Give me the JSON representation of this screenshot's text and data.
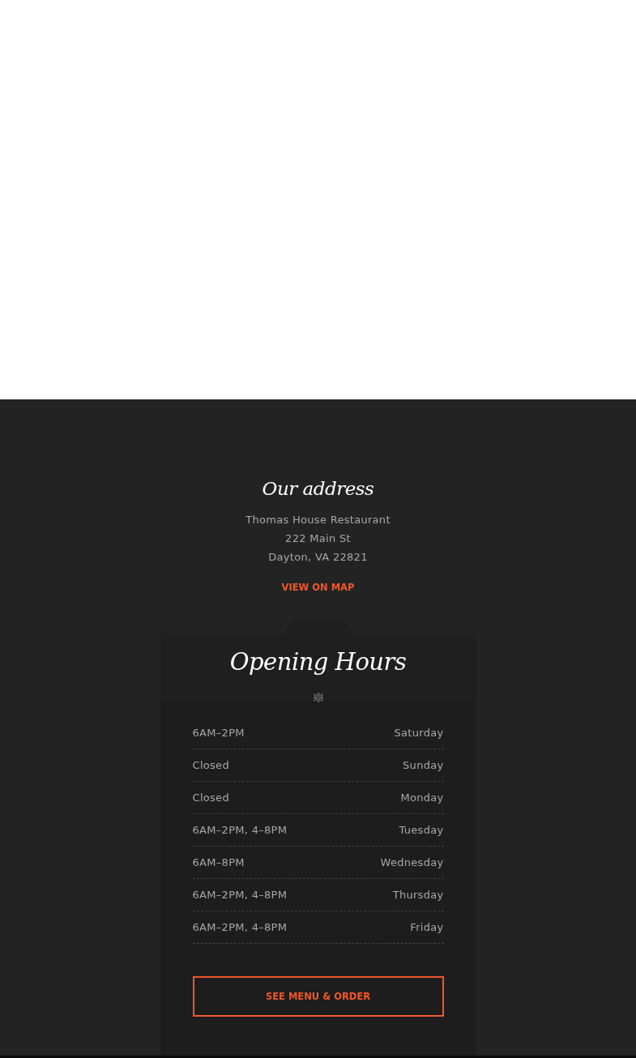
{
  "address": {
    "title": "Our address",
    "lines": [
      "Thomas House Restaurant",
      "222 Main St",
      "Dayton, VA 22821"
    ],
    "link": "VIEW ON MAP"
  },
  "hours": {
    "title": "Opening Hours",
    "rows": [
      {
        "time": "6AM–2PM",
        "day": "Saturday"
      },
      {
        "time": "Closed",
        "day": "Sunday"
      },
      {
        "time": "Closed",
        "day": "Monday"
      },
      {
        "time": "6AM–2PM, 4–8PM",
        "day": "Tuesday"
      },
      {
        "time": "6AM–8PM",
        "day": "Wednesday"
      },
      {
        "time": "6AM–2PM, 4–8PM",
        "day": "Thursday"
      },
      {
        "time": "6AM–2PM, 4–8PM",
        "day": "Friday"
      }
    ],
    "button": "SEE MENU & ORDER"
  }
}
